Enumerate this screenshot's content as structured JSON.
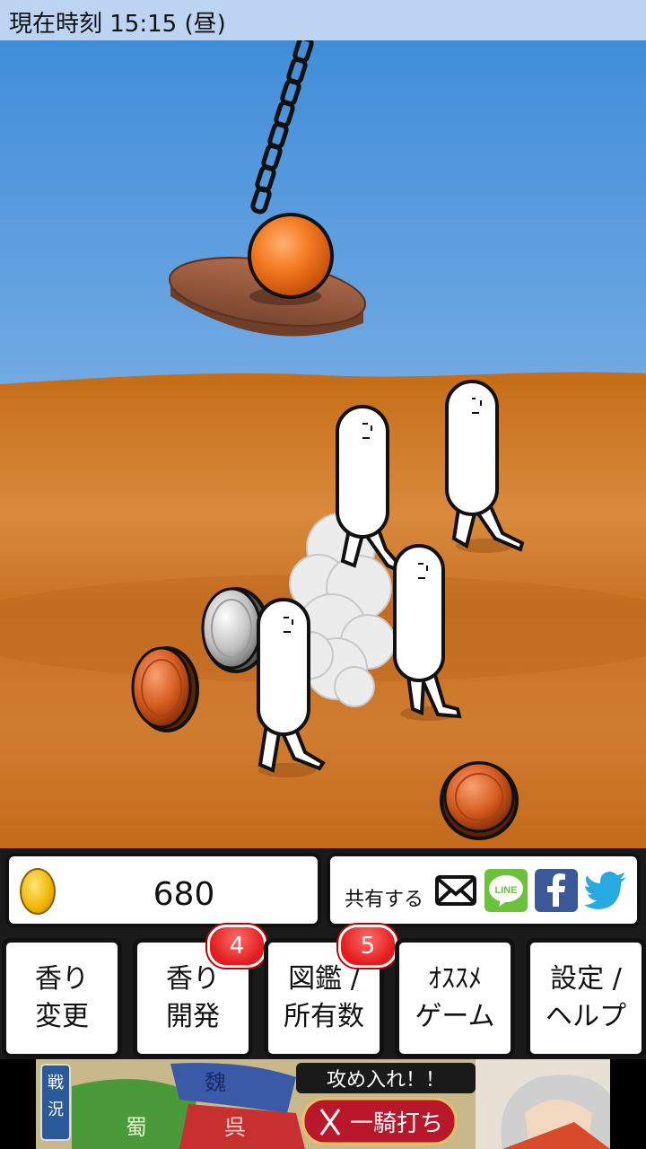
{
  "status": {
    "time_text": "現在時刻 15:15 (昼)"
  },
  "coins": {
    "count": "680"
  },
  "share": {
    "label": "共有する",
    "icons": [
      "mail-icon",
      "line-icon",
      "facebook-icon",
      "twitter-icon"
    ],
    "line_text": "LINE"
  },
  "buttons": [
    {
      "line1": "香り",
      "line2": "変更"
    },
    {
      "line1": "香り",
      "line2": "開発",
      "badge": "4"
    },
    {
      "line1": "図鑑 /",
      "line2": "所有数",
      "badge": "5"
    },
    {
      "line1": "ｵｽｽﾒ",
      "line2": "ゲーム"
    },
    {
      "line1": "設定 /",
      "line2": "ヘルプ"
    }
  ],
  "ad": {
    "badge": "戦況",
    "headline": "攻め入れ！！",
    "cta": "一騎打ち",
    "map_labels": [
      "魏",
      "蜀",
      "呉"
    ]
  },
  "colors": {
    "sky_top": "#3a8ad8",
    "sky_bottom": "#a9c9ef",
    "sand": "#c9741e",
    "badge": "#e21c1c"
  }
}
